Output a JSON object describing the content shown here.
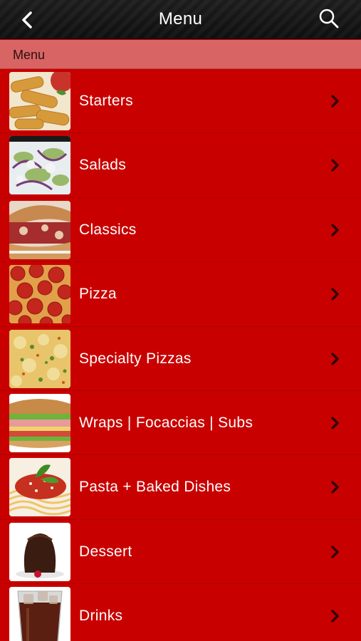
{
  "header": {
    "title": "Menu",
    "back_icon": "chevron-left-icon",
    "search_icon": "search-icon"
  },
  "section": {
    "label": "Menu"
  },
  "items": [
    {
      "label": "Starters",
      "image": "mozzarella-sticks"
    },
    {
      "label": "Salads",
      "image": "salad"
    },
    {
      "label": "Classics",
      "image": "sandwich"
    },
    {
      "label": "Pizza",
      "image": "pepperoni-pizza"
    },
    {
      "label": "Specialty Pizzas",
      "image": "veggie-pizza"
    },
    {
      "label": "Wraps | Focaccias | Subs",
      "image": "sub-sandwich"
    },
    {
      "label": "Pasta + Baked Dishes",
      "image": "spaghetti"
    },
    {
      "label": "Dessert",
      "image": "chocolate-cake"
    },
    {
      "label": "Drinks",
      "image": "cola-glass"
    }
  ],
  "colors": {
    "list_background": "#c80000",
    "section_header": "#d96464",
    "top_bar": "#151515"
  }
}
